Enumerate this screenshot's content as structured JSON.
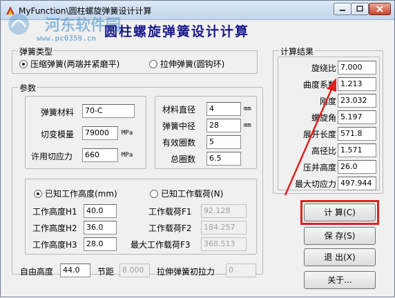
{
  "window": {
    "title": "MyFunction\\圆柱螺旋弹簧设计计算",
    "main_heading": "圆柱螺旋弹簧设计计算"
  },
  "watermark": {
    "text": "河东软件园",
    "url": "www.pc0359.cn"
  },
  "spring_type": {
    "legend": "弹簧类型",
    "options": [
      {
        "label": "压缩弹簧(两端并紧磨平)",
        "selected": true
      },
      {
        "label": "拉伸弹簧(圆钩环)",
        "selected": false
      }
    ]
  },
  "params": {
    "legend": "参数",
    "material_label": "弹簧材料",
    "material_value": "70-C",
    "shear_modulus_label": "切变模量",
    "shear_modulus_value": "79000",
    "shear_modulus_unit": "MPa",
    "allowable_stress_label": "许用切应力",
    "allowable_stress_value": "660",
    "allowable_stress_unit": "MPa",
    "wire_diameter_label": "材料直径",
    "wire_diameter_value": "4",
    "wire_diameter_unit": "mm",
    "mean_diameter_label": "弹簧中径",
    "mean_diameter_value": "28",
    "mean_diameter_unit": "mm",
    "active_coils_label": "有效圈数",
    "active_coils_value": "5",
    "total_coils_label": "总圈数",
    "total_coils_value": "6.5"
  },
  "work": {
    "option_height": {
      "label": "已知工作高度(mm)",
      "selected": true
    },
    "option_load": {
      "label": "已知工作载荷(N)",
      "selected": false
    },
    "h1_label": "工作高度H1",
    "h1_value": "40.0",
    "h2_label": "工作高度H2",
    "h2_value": "36.0",
    "h3_label": "工作高度H3",
    "h3_value": "28.0",
    "f1_label": "工作载荷F1",
    "f1_value": "92.128",
    "f2_label": "工作载荷F2",
    "f2_value": "184.257",
    "f3_label": "最大工作载荷F3",
    "f3_value": "368.513"
  },
  "bottom": {
    "free_height_label": "自由高度",
    "free_height_value": "44.0",
    "pitch_label": "节距",
    "pitch_value": "8.000",
    "initial_tension_label": "拉伸弹簧初拉力",
    "initial_tension_value": "0"
  },
  "results": {
    "legend": "计算结果",
    "rows": [
      {
        "label": "旋绕比",
        "value": "7.000"
      },
      {
        "label": "曲度系数",
        "value": "1.213"
      },
      {
        "label": "刚度",
        "value": "23.032"
      },
      {
        "label": "螺旋角",
        "value": "5.197"
      },
      {
        "label": "展开长度",
        "value": "571.8"
      },
      {
        "label": "高径比",
        "value": "1.571"
      },
      {
        "label": "压并高度",
        "value": "26.0"
      },
      {
        "label": "最大切应力",
        "value": "497.944"
      }
    ]
  },
  "buttons": {
    "calculate": "计 算(C)",
    "save": "保 存(S)",
    "exit": "退 出(X)",
    "about": "关于..."
  },
  "colors": {
    "heading": "#1a1a8c",
    "highlight": "#e01f1f",
    "watermark": "#3c8cc8"
  }
}
